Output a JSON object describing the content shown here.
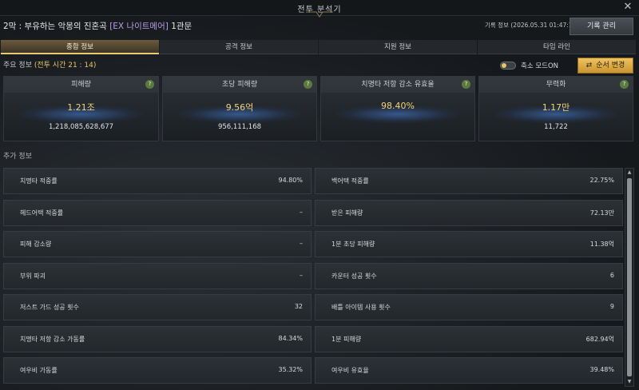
{
  "window": {
    "title": "전투 분석기"
  },
  "header": {
    "raid_prefix": "2막 : 부유하는 악몽의 진혼곡",
    "difficulty": "[EX 나이트메어]",
    "gate": "1관문",
    "record_info": "기록 정보 (2026.05.31 01:47:14)",
    "record_button": "기록 관리"
  },
  "tabs": [
    {
      "label": "종합 정보",
      "active": true
    },
    {
      "label": "공격 정보",
      "active": false
    },
    {
      "label": "지원 정보",
      "active": false
    },
    {
      "label": "타임 라인",
      "active": false
    }
  ],
  "main": {
    "label": "주요 정보",
    "battle_time": "(전투 시간 21 : 14)",
    "compact_mode": "축소 모드ON",
    "order_button": "순서 변경"
  },
  "cards": [
    {
      "title": "피해량",
      "short": "1.21조",
      "full": "1,218,085,628,677"
    },
    {
      "title": "초당 피해량",
      "short": "9.56억",
      "full": "956,111,168"
    },
    {
      "title": "치명타 저항 감소 유효율",
      "short": "98.40%",
      "full": ""
    },
    {
      "title": "무력화",
      "short": "1.17만",
      "full": "11,722"
    }
  ],
  "extra": {
    "label": "추가 정보",
    "left": [
      {
        "key": "치명타 적중률",
        "value": "94.80%"
      },
      {
        "key": "헤드어택 적중률",
        "value": "–"
      },
      {
        "key": "피해 감소량",
        "value": "–"
      },
      {
        "key": "부위 파괴",
        "value": "–"
      },
      {
        "key": "저스트 가드 성공 횟수",
        "value": "32"
      },
      {
        "key": "치명타 저항 감소 가동률",
        "value": "84.34%"
      },
      {
        "key": "여우비 가동률",
        "value": "35.32%"
      }
    ],
    "right": [
      {
        "key": "백어택 적중률",
        "value": "22.75%"
      },
      {
        "key": "받은 피해량",
        "value": "72.13만"
      },
      {
        "key": "1분 초당 피해량",
        "value": "11.38억"
      },
      {
        "key": "카운터 성공 횟수",
        "value": "6"
      },
      {
        "key": "배틀 아이템 사용 횟수",
        "value": "9"
      },
      {
        "key": "1분 피해량",
        "value": "682.94억"
      },
      {
        "key": "여우비 유효율",
        "value": "39.48%"
      }
    ]
  },
  "colors": {
    "accent_gold": "#e7c56c",
    "difficulty_purple": "#b79ae8",
    "help_green": "#5b7a3e"
  }
}
